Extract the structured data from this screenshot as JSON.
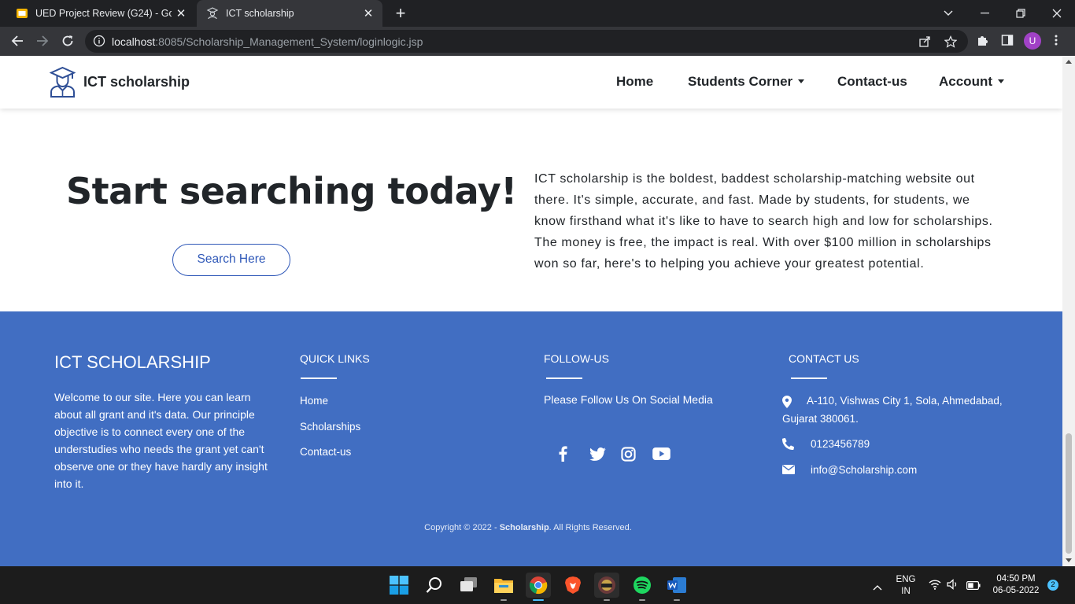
{
  "browser": {
    "tabs": [
      {
        "title": "UED Project Review (G24) - Goog",
        "state": "inactive"
      },
      {
        "title": "ICT scholarship",
        "state": "active"
      }
    ],
    "url_host": "localhost",
    "url_path": ":8085/Scholarship_Management_System/loginlogic.jsp",
    "profile_initial": "U"
  },
  "site_nav": {
    "brand": "ICT scholarship",
    "links": {
      "home": "Home",
      "students_corner": "Students Corner",
      "contact": "Contact-us",
      "account": "Account"
    }
  },
  "hero": {
    "title": "Start searching today!",
    "button": "Search Here",
    "description": "ICT scholarship is the boldest, baddest scholarship-matching website out there. It's simple, accurate, and fast. Made by students, for students, we know firsthand what it's like to have to search high and low for scholarships. The money is free, the impact is real. With over $100 million in scholarships won so far, here's to helping you achieve your greatest potential."
  },
  "footer": {
    "title": "ICT SCHOLARSHIP",
    "about": "Welcome to our site. Here you can learn about all grant and it's data. Our principle objective is to connect every one of the understudies who needs the grant yet can't observe one or they have hardly any insight into it.",
    "quick_links": {
      "heading": "QUICK LINKS",
      "items": [
        "Home",
        "Scholarships",
        "Contact-us"
      ]
    },
    "follow": {
      "heading": "FOLLOW-US",
      "text": "Please Follow Us On Social Media",
      "icons": [
        "facebook-icon",
        "twitter-icon",
        "instagram-icon",
        "youtube-icon"
      ]
    },
    "contact": {
      "heading": "CONTACT US",
      "address_line1": "A-110, Vishwas City 1, Sola, Ahmedabad,",
      "address_line2": "Gujarat 380061.",
      "phone": "0123456789",
      "email": "info@Scholarship.com"
    },
    "copyright_prefix": "Copyright © 2022 - ",
    "copyright_brand": "Scholarship",
    "copyright_suffix": ". All Rights Reserved."
  },
  "taskbar": {
    "lang_line1": "ENG",
    "lang_line2": "IN",
    "time": "04:50 PM",
    "date": "06-05-2022",
    "notifications": "2"
  },
  "colors": {
    "footer_bg": "#416ec2",
    "accent_blue": "#2f58b8",
    "chrome_dark": "#202124",
    "chrome_toolbar": "#35363a"
  }
}
